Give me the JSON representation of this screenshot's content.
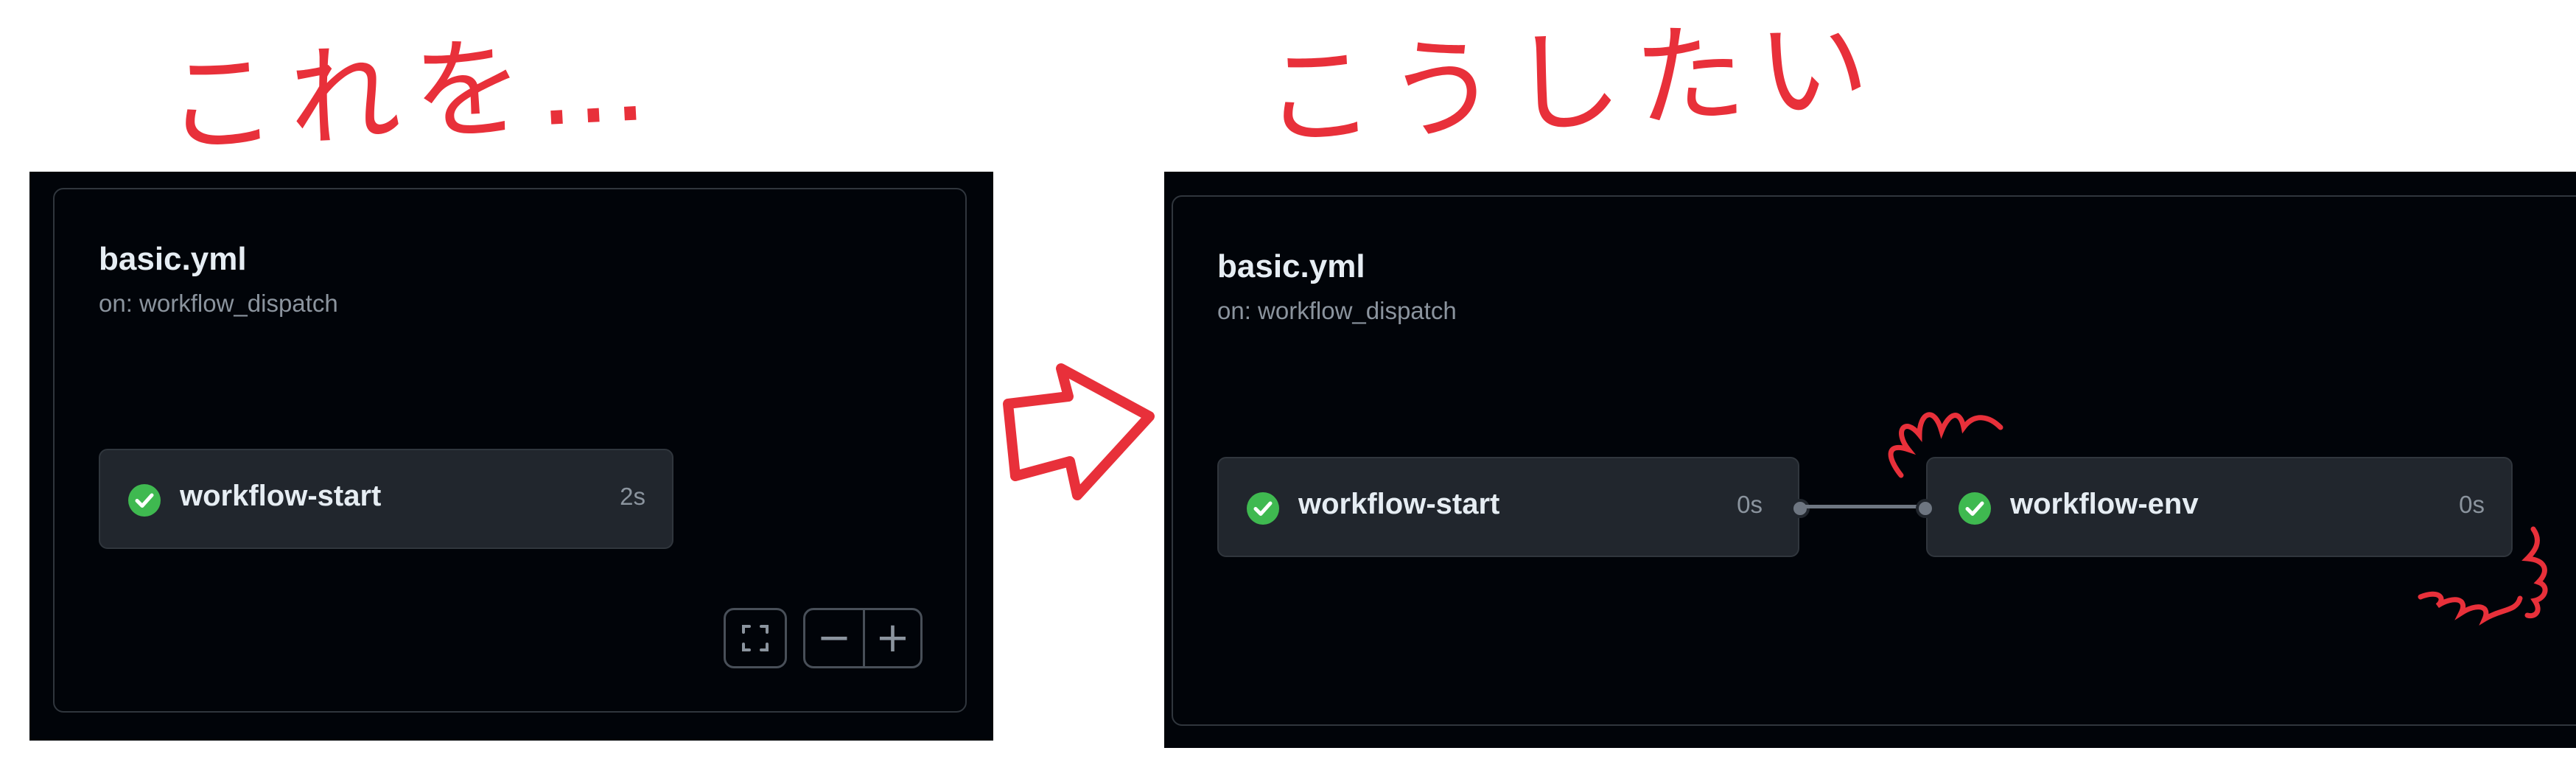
{
  "annotations": {
    "before_caption": "これを…",
    "after_caption": "こうしたい",
    "color": "#e8303a"
  },
  "before": {
    "workflow": {
      "title": "basic.yml",
      "trigger": "on: workflow_dispatch"
    },
    "jobs": [
      {
        "name": "workflow-start",
        "duration": "2s",
        "status": "success"
      }
    ],
    "controls": {
      "fullscreen_icon": "fullscreen-icon",
      "zoom_out_label": "−",
      "zoom_in_label": "+"
    }
  },
  "after": {
    "workflow": {
      "title": "basic.yml",
      "trigger": "on: workflow_dispatch"
    },
    "jobs": [
      {
        "name": "workflow-start",
        "duration": "0s",
        "status": "success"
      },
      {
        "name": "workflow-env",
        "duration": "0s",
        "status": "success"
      }
    ]
  },
  "colors": {
    "background": "#010409",
    "card_border": "#30363d",
    "job_bg": "#21262d",
    "success": "#3fb950",
    "text_primary": "#e6edf3",
    "text_muted": "#8b949e",
    "annotation": "#e8303a"
  }
}
